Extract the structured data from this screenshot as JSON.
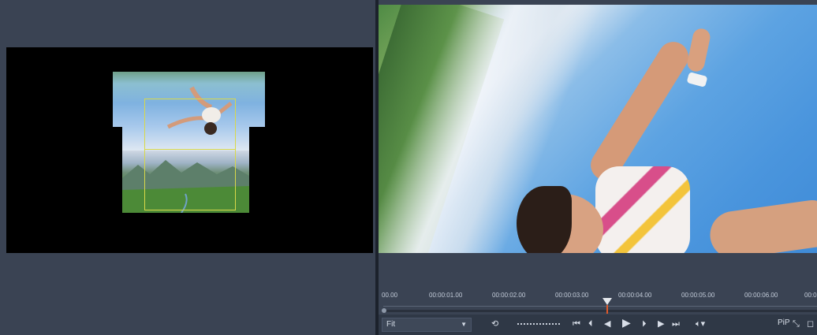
{
  "timeline": {
    "ticks": [
      "00.00",
      "00:00:01.00",
      "00:00:02.00",
      "00:00:03.00",
      "00:00:04.00",
      "00:00:05.00",
      "00:00:06.00",
      "00:0"
    ]
  },
  "controls": {
    "fit_value": "Fit",
    "pip_label": "PiP",
    "icons": [
      "loop-icon",
      "shuttle-control",
      "go-to-start-icon",
      "previous-frame-icon",
      "step-back-icon",
      "play-icon",
      "step-forward-icon",
      "next-frame-icon",
      "go-to-end-icon",
      "volume-icon",
      "pip-icon",
      "expand-icon"
    ]
  },
  "colors": {
    "panel_bg": "#3a4353",
    "crop_frame": "#d8d84a",
    "playhead_line": "#e05a2b"
  }
}
